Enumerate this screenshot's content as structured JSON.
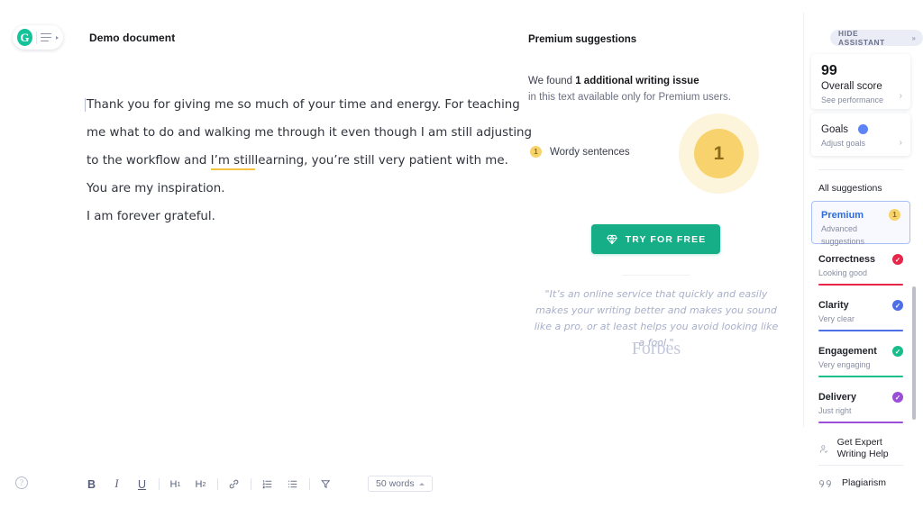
{
  "editor": {
    "logo_letter": "G",
    "doc_title": "Demo document",
    "paragraphs": [
      "Thank you for giving me so much of your time and energy. For teaching",
      "me what to do and walking me through it even though I am still adjusting",
      "to the workflow and ",
      "learning, you’re still very patient with me.",
      "You are my inspiration.",
      "I am forever grateful."
    ],
    "highlighted_text": "I’m still",
    "toolbar": {
      "bold": "B",
      "italic": "I",
      "underline": "U",
      "h1": "H1",
      "h2": "H2",
      "link_icon": "link-icon",
      "ordered_list_icon": "ordered-list-icon",
      "bullet_list_icon": "bullet-list-icon",
      "clear_format_icon": "clear-formatting-icon",
      "help_icon": "help-icon"
    },
    "word_count": "50 words"
  },
  "premium": {
    "title": "Premium suggestions",
    "found_prefix": "We found ",
    "found_bold": "1 additional writing issue",
    "found_sub": "in this text available only for Premium users.",
    "issue_badge": "1",
    "issue_label": "Wordy sentences",
    "halo_count": "1",
    "cta_label": "TRY FOR FREE",
    "cta_icon": "diamond-icon",
    "quote": "\"It’s an online service that quickly and easily makes your writing better and makes you sound like a pro, or at least helps you avoid looking like a fool.\"",
    "quote_source": "Forbes"
  },
  "assistant": {
    "hide_label": "HIDE ASSISTANT",
    "hide_chevrons": "»",
    "score_value": "99",
    "score_label": "Overall score",
    "score_link": "See performance",
    "goals_title": "Goals",
    "goals_sub": "Adjust goals",
    "chevron": "›",
    "all_suggestions": "All suggestions",
    "premium_card": {
      "title": "Premium",
      "sub": "Advanced suggestions",
      "badge": "1"
    },
    "categories": [
      {
        "name": "Correctness",
        "status": "Looking good",
        "color": "#E8264A"
      },
      {
        "name": "Clarity",
        "status": "Very clear",
        "color": "#4C6FE6"
      },
      {
        "name": "Engagement",
        "status": "Very engaging",
        "color": "#17BE8B"
      },
      {
        "name": "Delivery",
        "status": "Just right",
        "color": "#9A4DD6"
      }
    ],
    "services": [
      {
        "label": "Get Expert Writing Help",
        "icon": "expert-person-icon"
      },
      {
        "label": "Plagiarism",
        "icon": "quotation-marks-icon"
      }
    ]
  },
  "colors": {
    "brand_green": "#15C39A",
    "cta_green": "#15AE87",
    "premium_yellow": "#F8D36D",
    "premium_blue": "#2E6DE0"
  }
}
